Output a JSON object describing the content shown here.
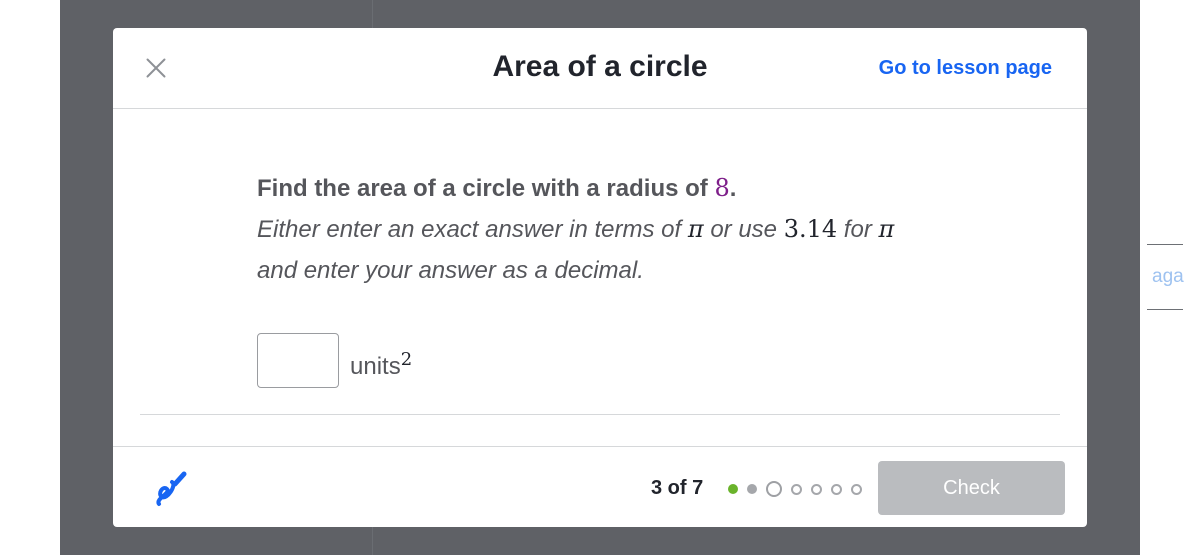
{
  "background": {
    "partial_text": "aga"
  },
  "header": {
    "title": "Area of a circle",
    "lesson_link": "Go to lesson page"
  },
  "question": {
    "prompt_prefix": "Find the area of a circle with a radius of ",
    "radius": "8",
    "prompt_suffix": ".",
    "instruction_1": "Either enter an exact answer in terms of ",
    "pi": "π",
    "instruction_2": " or use ",
    "approx_value": "3.14",
    "instruction_3": " for ",
    "instruction_4": "and enter your answer as a decimal."
  },
  "answer": {
    "value": "",
    "units": "units",
    "exponent": "2"
  },
  "footer": {
    "progress_text": "3 of 7",
    "progress": {
      "current": 3,
      "total": 7,
      "states": [
        "correct",
        "done",
        "current",
        "todo",
        "todo",
        "todo",
        "todo"
      ]
    },
    "check_label": "Check"
  },
  "colors": {
    "accent_link": "#1865f2",
    "correct_dot": "#6ab32b",
    "radius_value": "#7e1f8a",
    "check_disabled": "#babcbf"
  },
  "icons": {
    "close": "close-icon",
    "scratchpad": "scratchpad-pen-icon"
  }
}
